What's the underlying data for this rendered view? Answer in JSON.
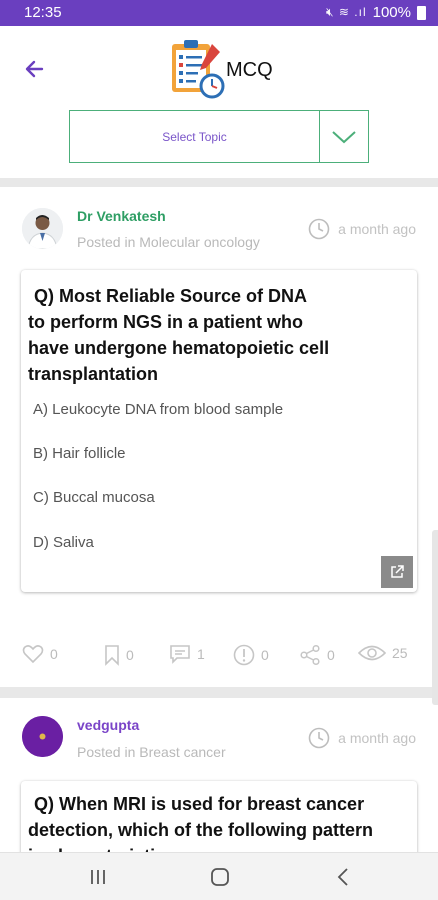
{
  "status_bar": {
    "time": "12:35",
    "battery": "100%"
  },
  "header": {
    "title": "MCQ",
    "select_placeholder": "Select Topic"
  },
  "colors": {
    "accent": "#6a3fbf",
    "green": "#2e9e64",
    "purple_author": "#7a44c8"
  },
  "posts": [
    {
      "author": "Dr Venkatesh",
      "posted_in": "Posted in Molecular oncology",
      "time": "a month ago",
      "question": "Q)  Most Reliable Source of DNA to perform NGS in a patient who have undergone hematopoietic cell transplantation",
      "question_lines": [
        "Q)  Most Reliable Source of DNA",
        "to perform NGS in a patient who",
        "have undergone hematopoietic cell",
        "transplantation"
      ],
      "options": [
        "A) Leukocyte DNA from blood sample",
        "B) Hair follicle",
        "C) Buccal mucosa",
        "D) Saliva"
      ],
      "stats": {
        "likes": "0",
        "bookmarks": "0",
        "comments": "1",
        "reports": "0",
        "shares": "0",
        "views": "25"
      }
    },
    {
      "author": "vedgupta",
      "posted_in": "Posted in Breast cancer",
      "time": "a month ago",
      "question_lines": [
        "Q) When MRI is used for breast cancer",
        "detection, which of the following pattern",
        "is characteristic..."
      ]
    }
  ]
}
